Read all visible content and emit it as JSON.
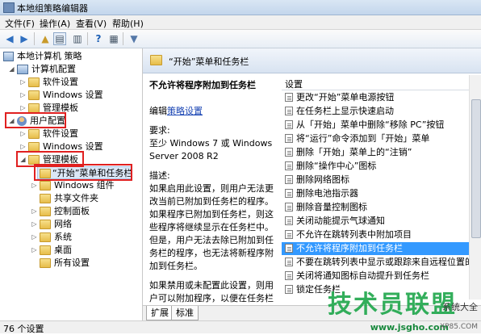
{
  "window": {
    "title": "本地组策略编辑器"
  },
  "menu": [
    "文件(F)",
    "操作(A)",
    "查看(V)",
    "帮助(H)"
  ],
  "toolbar_icons": [
    "back-arrow-icon",
    "forward-arrow-icon",
    "up-folder-icon",
    "show-tree-icon",
    "show-hide-icon",
    "help-icon",
    "properties-icon",
    "filter-icon"
  ],
  "tree": [
    {
      "label": "本地计算机 策略"
    },
    {
      "label": "计算机配置"
    },
    {
      "label": "软件设置"
    },
    {
      "label": "Windows 设置"
    },
    {
      "label": "管理模板"
    },
    {
      "label": "用户配置"
    },
    {
      "label": "软件设置"
    },
    {
      "label": "Windows 设置"
    },
    {
      "label": "管理模板"
    },
    {
      "label": "“开始”菜单和任务栏"
    },
    {
      "label": "Windows 组件"
    },
    {
      "label": "共享文件夹"
    },
    {
      "label": "控制面板"
    },
    {
      "label": "网络"
    },
    {
      "label": "系统"
    },
    {
      "label": "桌面"
    },
    {
      "label": "所有设置"
    }
  ],
  "header": {
    "title": "“开始”菜单和任务栏"
  },
  "description": {
    "heading": "不允许将程序附加到任务栏",
    "edit_prefix": "编辑",
    "edit_link": "策略设置",
    "req_label": "要求:",
    "req_text": "至少 Windows 7 或 Windows Server 2008 R2",
    "desc_label": "描述:",
    "desc_text": "如果启用此设置，则用户无法更改当前已附加到任务栏的程序。如果程序已附加到任务栏，则这些程序将继续显示在任务栏中。但是，用户无法去除已附加到任务栏的程序，也无法将新程序附加到任务栏。",
    "desc_text2": "如果禁用或未配置此设置，则用户可以附加程序，以便在任务栏上保"
  },
  "list": {
    "header": "设置",
    "items": [
      "更改“开始”菜单电源按钮",
      "在任务栏上显示快速启动",
      "从「开始」菜单中删除“移除 PC”按钮",
      "将“运行”命令添加到「开始」菜单",
      "删除「开始」菜单上的“注销”",
      "删除“操作中心”图标",
      "删除网络图标",
      "删除电池指示器",
      "删除音量控制图标",
      "关闭动能提示气球通知",
      "不允许在跳转列表中附加项目",
      "不允许将程序附加到任务栏",
      "不要在跳转列表中显示或跟踪来自远程位置的项目",
      "关闭将通知图标自动提升到任务栏",
      "锁定任务栏"
    ],
    "selected_index": 11
  },
  "tabs": [
    "扩展",
    "标准"
  ],
  "status": "76 个设置",
  "watermark": {
    "big": "技术员联盟",
    "url": "www.jsgho.com",
    "right": "系统大全",
    "small": "XP85.COM"
  },
  "colors": {
    "selection": "#3399ff",
    "red_box": "#e02020",
    "link": "#1b46b4"
  }
}
